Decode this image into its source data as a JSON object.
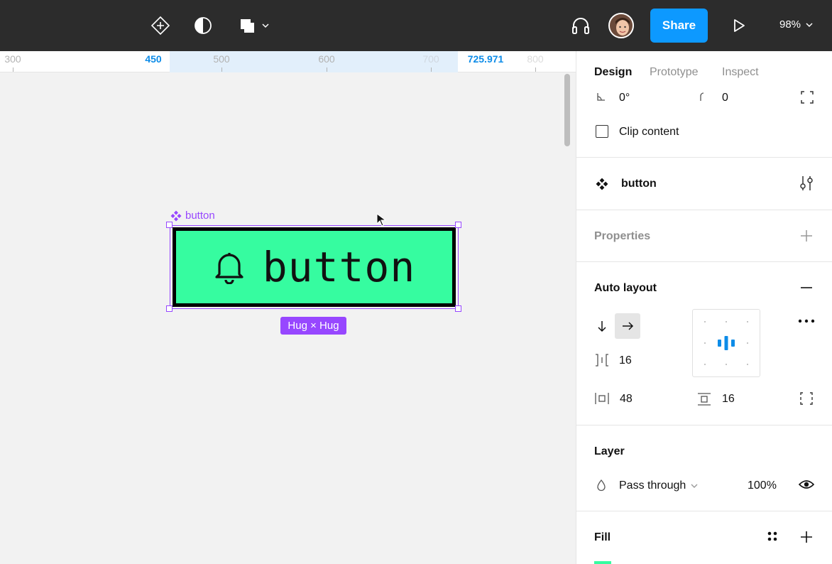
{
  "toolbar": {
    "icons": [
      "component-icon",
      "contrast-icon",
      "boolean-shapes-icon",
      "chevron-down-icon",
      "headphones-icon",
      "present-icon"
    ],
    "share_label": "Share",
    "zoom_label": "98%"
  },
  "ruler": {
    "ticks": [
      {
        "label": "300",
        "selected": false
      },
      {
        "label": "450",
        "selected": true
      },
      {
        "label": "500",
        "selected": false
      },
      {
        "label": "600",
        "selected": false
      },
      {
        "label": "700",
        "selected": false
      },
      {
        "label": "725.971",
        "selected": true
      },
      {
        "label": "800",
        "selected": false
      }
    ]
  },
  "canvas": {
    "component_label": "button",
    "button_text": "button",
    "size_badge": "Hug × Hug",
    "colors": {
      "button_fill": "#36fca0",
      "selection": "#9747ff"
    }
  },
  "panel": {
    "tabs": [
      {
        "label": "Design",
        "active": true
      },
      {
        "label": "Prototype",
        "active": false
      },
      {
        "label": "Inspect",
        "active": false
      }
    ],
    "rotation_value": "0°",
    "radius_value": "0",
    "clip_content_label": "Clip content",
    "component_name": "button",
    "properties_title": "Properties",
    "auto_layout": {
      "title": "Auto layout",
      "gap": "16",
      "horizontal_padding": "48",
      "vertical_padding": "16",
      "direction": "horizontal"
    },
    "layer": {
      "title": "Layer",
      "blend_mode": "Pass through",
      "opacity": "100%"
    },
    "fill": {
      "title": "Fill",
      "color": "#36fca0"
    }
  }
}
